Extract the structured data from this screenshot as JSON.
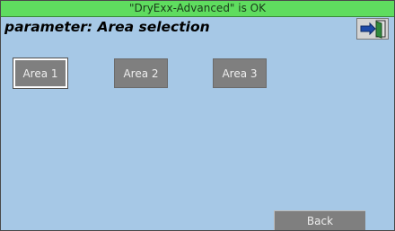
{
  "status": {
    "text": "\"DryExx-Advanced\" is OK"
  },
  "header": {
    "title": "parameter: Area selection",
    "exit_icon": "exit-door-icon"
  },
  "areas": [
    {
      "label": "Area 1",
      "selected": true
    },
    {
      "label": "Area 2",
      "selected": false
    },
    {
      "label": "Area 3",
      "selected": false
    }
  ],
  "footer": {
    "back_label": "Back"
  },
  "colors": {
    "status_bar": "#5fdc5f",
    "background": "#a6c8e6",
    "button": "#7f7f7f",
    "button_text": "#eeeeee"
  }
}
